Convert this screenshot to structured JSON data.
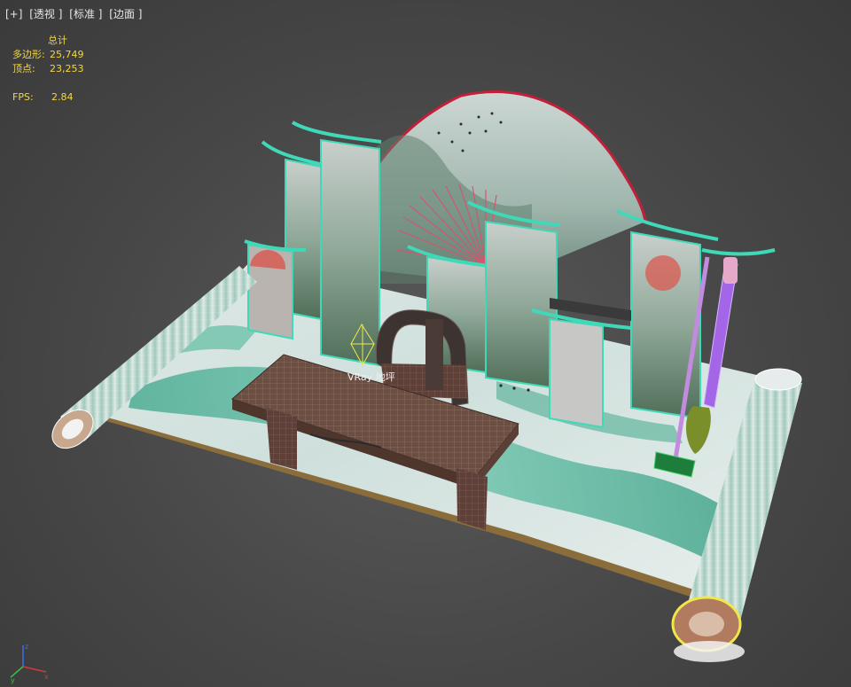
{
  "viewport": {
    "label_parts": [
      "[+]",
      "[透视 ]",
      "[标准 ]",
      "[边面 ]"
    ]
  },
  "stats": {
    "header": "总计",
    "polygons_label": "多边形:",
    "polygons_value": "25,749",
    "vertices_label": "顶点:",
    "vertices_value": "23,253",
    "fps_label": "FPS:",
    "fps_value": "2.84"
  },
  "scene": {
    "light_label": "VRay 地坪",
    "objects": [
      "scroll-mat",
      "fan-backdrop",
      "hanging-panels",
      "tea-table",
      "armchair",
      "left-scroll-roll",
      "right-scroll-roll",
      "lamp-stand",
      "folding-fan"
    ]
  },
  "axes": {
    "x": "x",
    "y": "y",
    "z": "z"
  },
  "colors": {
    "background": "#474747",
    "stats_text": "#f2d64a",
    "panel_edge": "#3fd9b8",
    "fan_edge": "#c2203a",
    "selection": "#f0e84a"
  }
}
